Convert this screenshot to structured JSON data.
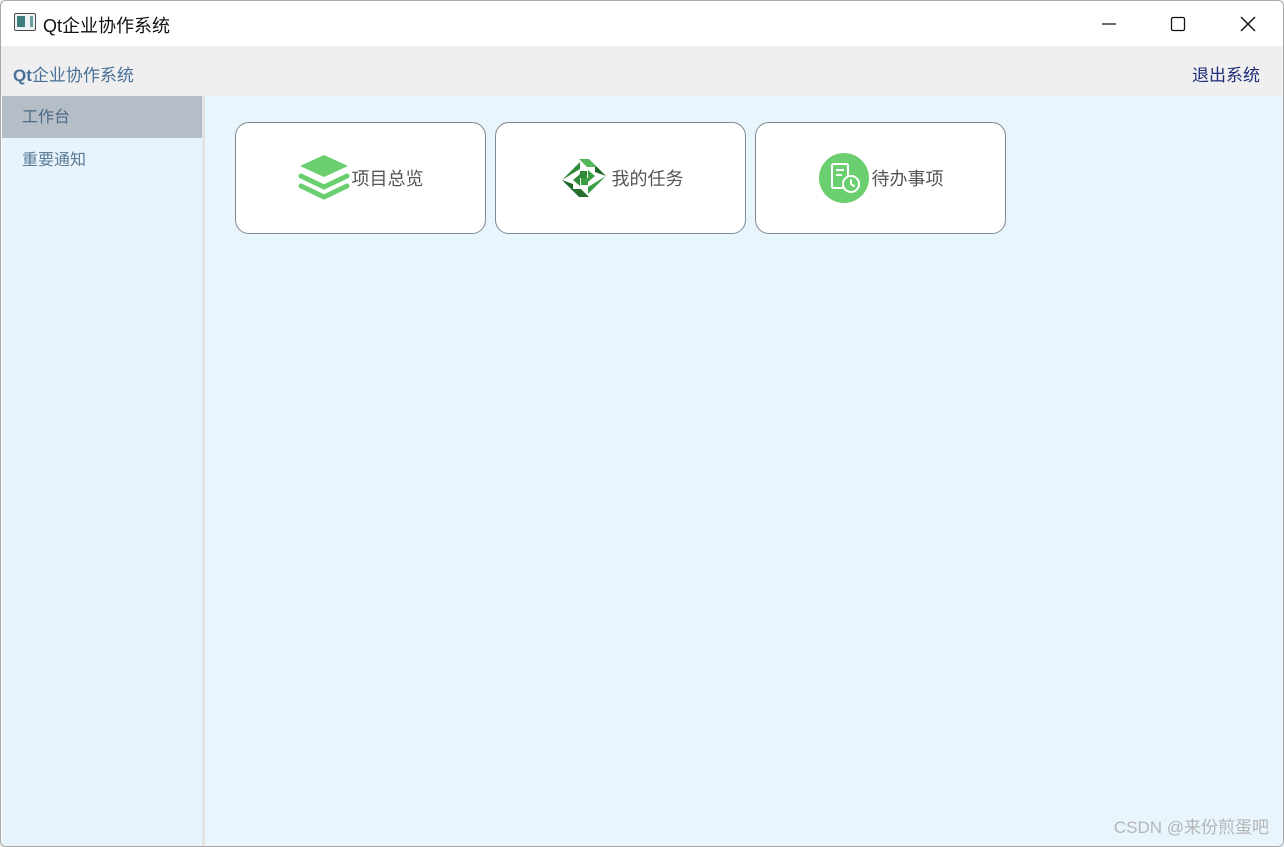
{
  "window": {
    "title": "Qt企业协作系统"
  },
  "header": {
    "title_prefix": "Qt",
    "title_rest": "企业协作系统",
    "logout_label": "退出系统"
  },
  "sidebar": {
    "items": [
      {
        "label": "工作台",
        "active": true
      },
      {
        "label": "重要通知",
        "active": false
      }
    ]
  },
  "main": {
    "cards": [
      {
        "label": "项目总览",
        "icon": "layers-icon"
      },
      {
        "label": "我的任务",
        "icon": "task-swap-icon"
      },
      {
        "label": "待办事项",
        "icon": "todo-clock-icon"
      }
    ]
  },
  "watermark": "CSDN @来份煎蛋吧",
  "colors": {
    "accent_green": "#6ccf6f",
    "dark_green": "#2f8a3a",
    "sidebar_bg": "#e8f4fc",
    "main_bg": "#e8f5fd",
    "active_item_bg": "#b5bec6"
  }
}
